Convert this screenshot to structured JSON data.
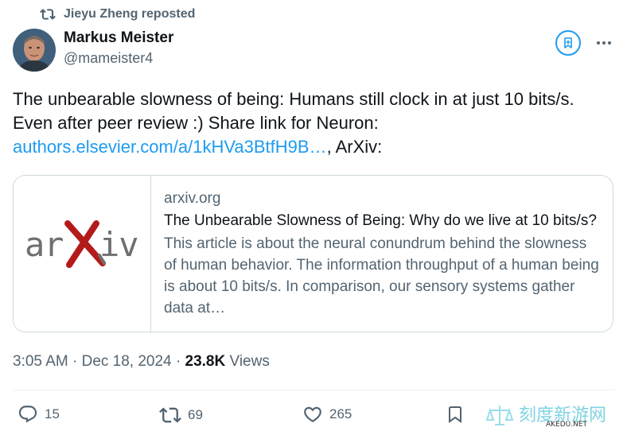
{
  "repost": {
    "text": "Jieyu Zheng reposted",
    "icon": "repost-icon"
  },
  "author": {
    "name": "Markus Meister",
    "handle": "@mameister4",
    "avatar": "avatar-photo"
  },
  "tweet": {
    "text1": "The unbearable slowness of being: Humans still clock in at just 10 bits/s. Even after peer review :) Share link for Neuron: ",
    "link": "authors.elsevier.com/a/1kHVa3BtfH9B…",
    "text2": ", ArXiv:"
  },
  "card": {
    "logo_text": "arXiv",
    "domain": "arxiv.org",
    "title": "The Unbearable Slowness of Being: Why do we live at 10 bits/s?",
    "description": "This article is about the neural conundrum behind the slowness of human behavior. The information throughput of a human being is about 10 bits/s. In comparison, our sensory systems gather data at…"
  },
  "meta": {
    "time": "3:05 AM · Dec 18, 2024 · ",
    "views_count": "23.8K",
    "views_label": " Views"
  },
  "actions": {
    "replies": "15",
    "reposts": "69",
    "likes": "265"
  },
  "watermark": {
    "text": "刻度新游网",
    "subtext": "AKEDU.NET"
  },
  "colors": {
    "accent": "#1d9bf0",
    "secondary": "#536471",
    "primary": "#0f1419",
    "arxiv_red": "#b31b1b"
  }
}
